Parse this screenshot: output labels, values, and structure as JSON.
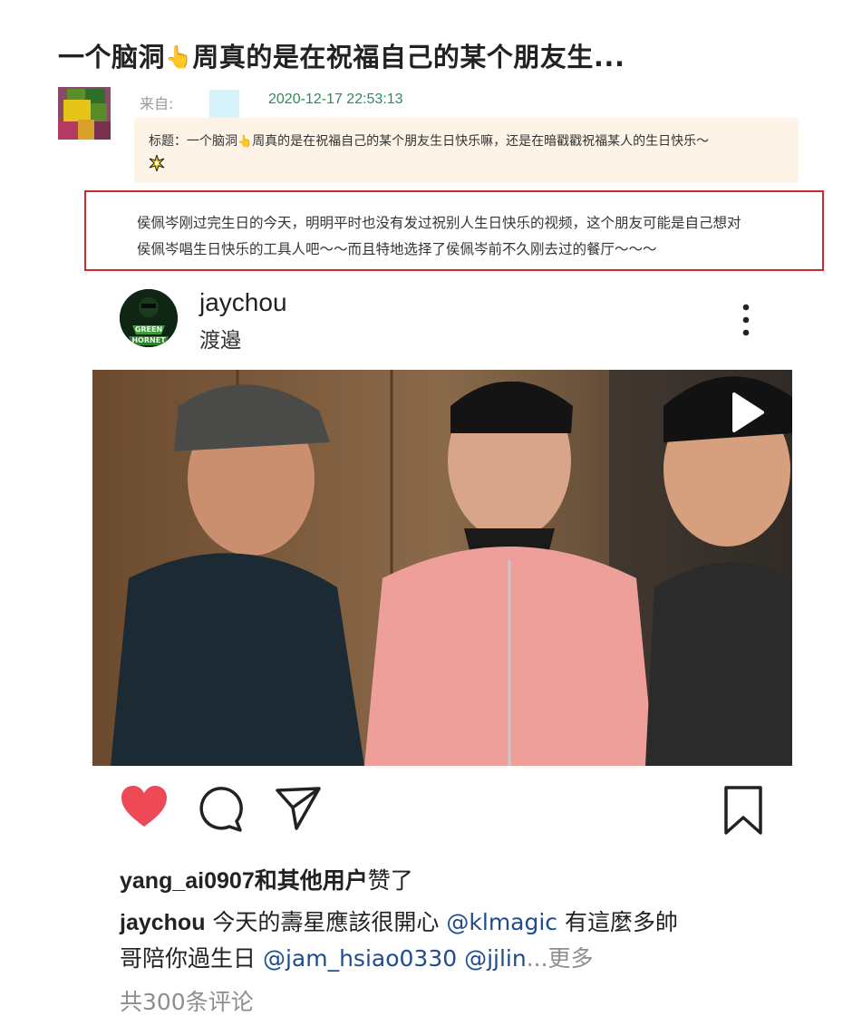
{
  "post": {
    "title": "一个脑洞👆周真的是在祝福自己的某个朋友生...",
    "title_before": "一个脑洞",
    "title_after": "周真的是在祝福自己的某个朋友生...",
    "from_label": "来自:",
    "date": "2020-12-17 22:53:13",
    "subject_before": "标题：一个脑洞",
    "subject_after": "周真的是在祝福自己的某个朋友生日快乐嘛，还是在暗戳戳祝福某人的生日快乐～",
    "body_line1": "侯佩岑刚过完生日的今天，明明平时也没有发过祝别人生日快乐的视频，这个朋友可能是自己想对",
    "body_line2": "侯佩岑唱生日快乐的工具人吧～～而且特地选择了侯佩岑前不久刚去过的餐厅～～～"
  },
  "instagram": {
    "username": "jaychou",
    "location": "渡邉",
    "likes_user": "yang_ai0907",
    "likes_mid": "和其他用户",
    "likes_end": "赞了",
    "caption_user": "jaychou",
    "caption_text1": " 今天的壽星應該很開心 ",
    "mention1": "@klmagic",
    "caption_text2": " 有這麼多帥",
    "caption_line2_start": "哥陪你過生日 ",
    "mention2": "@jam_hsiao0330",
    "mention3": " @jjlin",
    "more_text": "...更多",
    "comments": "共300条评论",
    "liked": true
  },
  "icons": {
    "finger": "pointing-up-finger-icon",
    "sparkle": "sparkle-icon",
    "heart": "heart-icon",
    "comment": "comment-icon",
    "share": "share-icon",
    "bookmark": "bookmark-icon",
    "more": "more-vertical-icon",
    "play": "play-icon"
  },
  "colors": {
    "date": "#2e8b57",
    "highlight_border": "#c72b2b",
    "subject_bg": "#fdf4e7",
    "heart": "#ed4956",
    "mention": "#1f4c8f"
  }
}
